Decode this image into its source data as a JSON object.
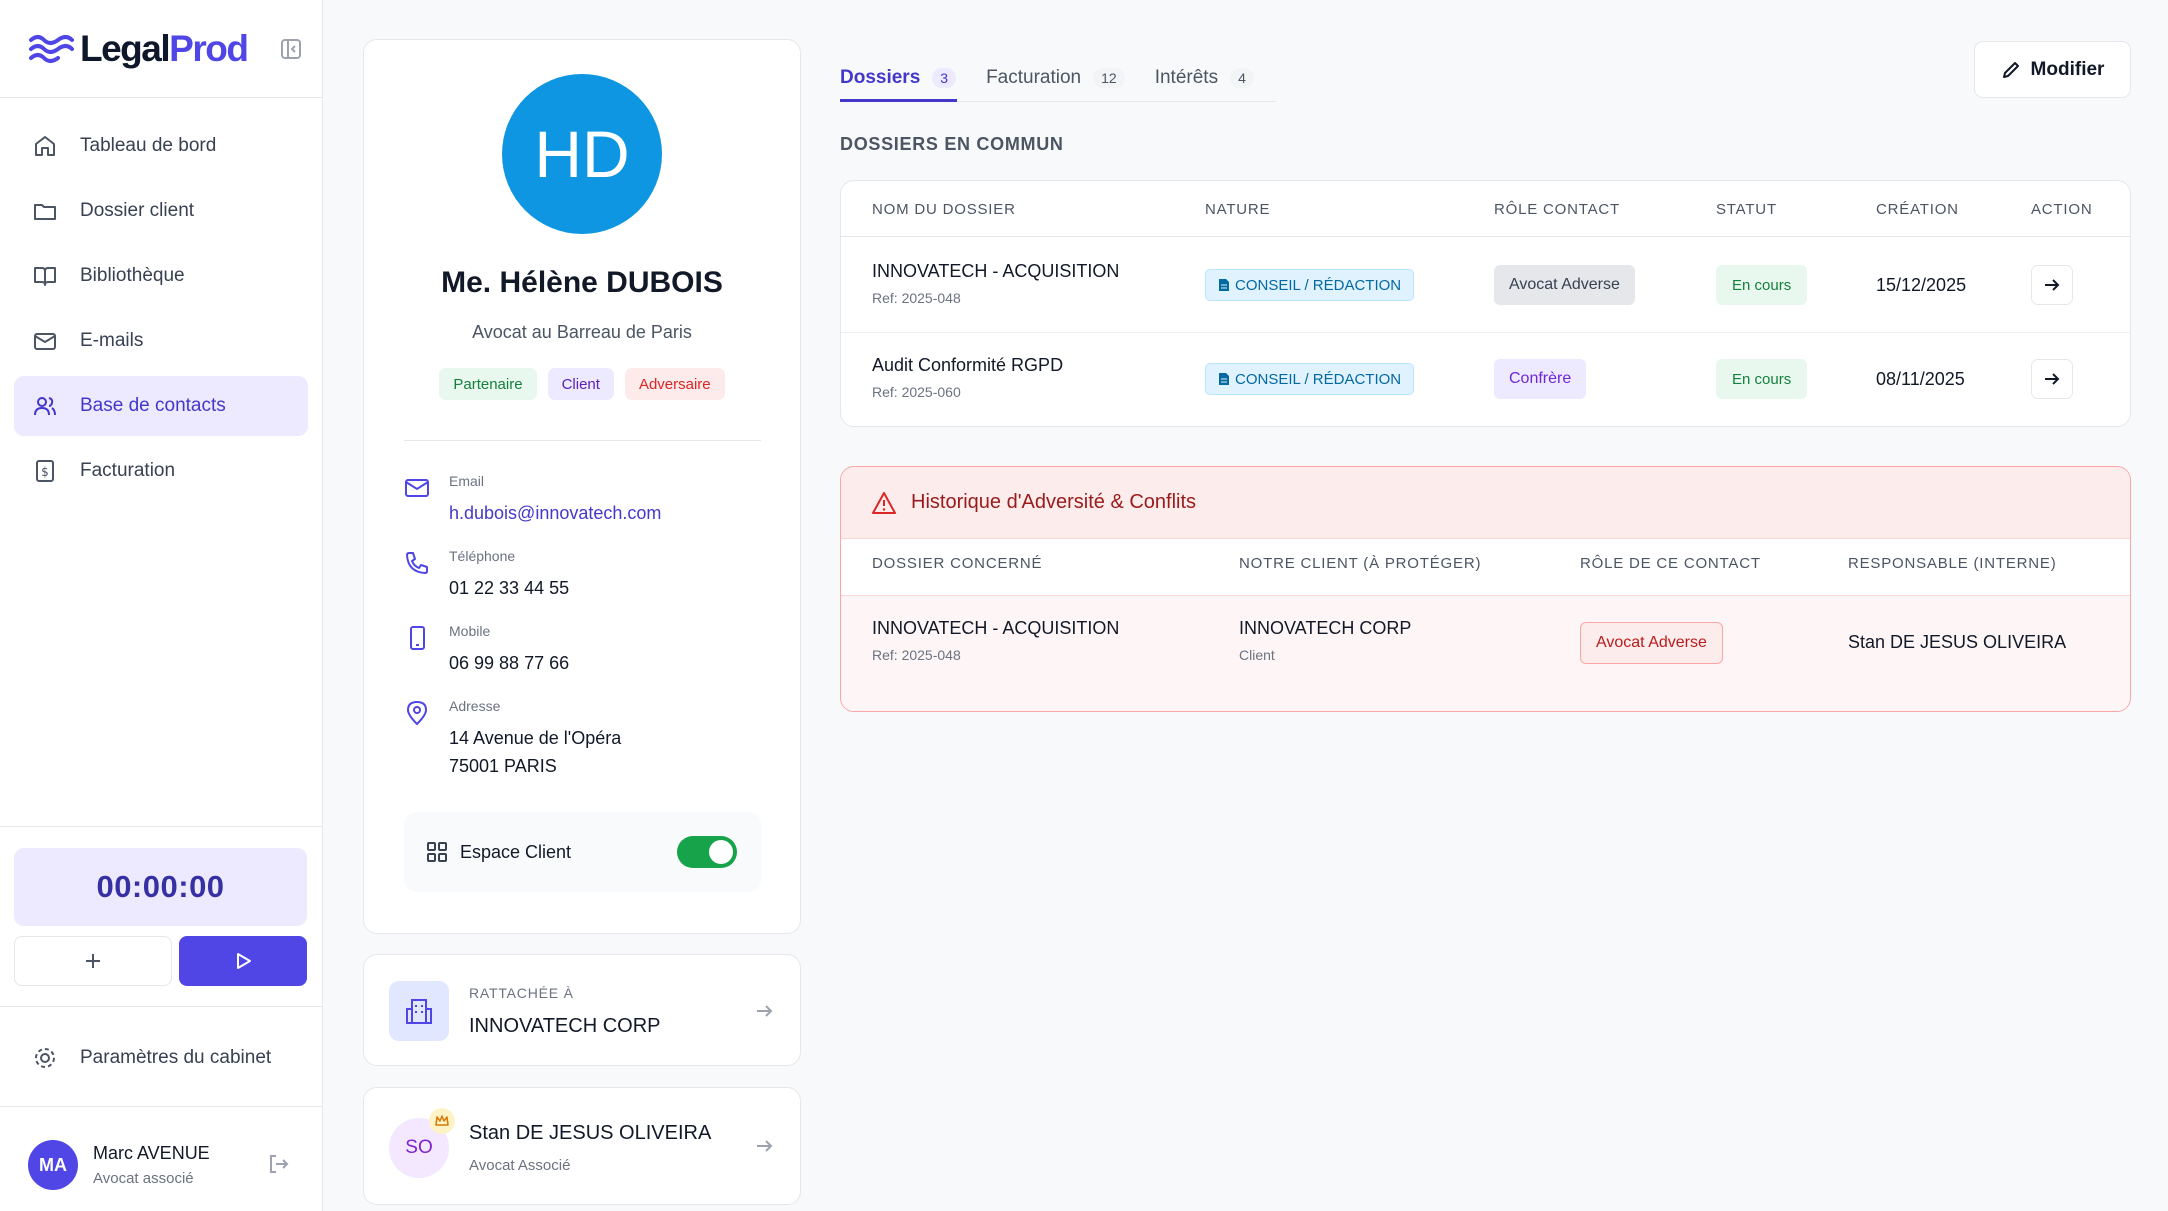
{
  "app": {
    "logo_legal": "Legal",
    "logo_prod": "Prod"
  },
  "sidebar": {
    "items": [
      {
        "label": "Tableau de bord",
        "icon": "home-icon"
      },
      {
        "label": "Dossier client",
        "icon": "folder-icon"
      },
      {
        "label": "Bibliothèque",
        "icon": "book-icon"
      },
      {
        "label": "E-mails",
        "icon": "mail-icon"
      },
      {
        "label": "Base de contacts",
        "icon": "users-icon",
        "active": true
      },
      {
        "label": "Facturation",
        "icon": "invoice-icon"
      }
    ],
    "timer": "00:00:00",
    "settings_label": "Paramètres du cabinet",
    "user": {
      "initials": "MA",
      "name": "Marc AVENUE",
      "role": "Avocat associé"
    }
  },
  "profile": {
    "initials": "HD",
    "name": "Me. Hélène DUBOIS",
    "title": "Avocat au Barreau de Paris",
    "tags": [
      "Partenaire",
      "Client",
      "Adversaire"
    ],
    "email_label": "Email",
    "email": "h.dubois@innovatech.com",
    "phone_label": "Téléphone",
    "phone": "01 22 33 44 55",
    "mobile_label": "Mobile",
    "mobile": "06 99 88 77 66",
    "address_label": "Adresse",
    "address_line1": "14 Avenue de l'Opéra",
    "address_line2": "75001 PARIS",
    "espace_client_label": "Espace Client",
    "espace_client_enabled": true
  },
  "rattachee": {
    "label": "RATTACHÉE À",
    "value": "INNOVATECH CORP"
  },
  "responsable": {
    "initials": "SO",
    "name": "Stan DE JESUS OLIVEIRA",
    "role": "Avocat Associé"
  },
  "tabs": [
    {
      "label": "Dossiers",
      "count": "3",
      "active": true
    },
    {
      "label": "Facturation",
      "count": "12"
    },
    {
      "label": "Intérêts",
      "count": "4"
    }
  ],
  "modifier_label": "Modifier",
  "dossiers": {
    "section_title": "DOSSIERS EN COMMUN",
    "headers": [
      "NOM DU DOSSIER",
      "NATURE",
      "RÔLE CONTACT",
      "STATUT",
      "CRÉATION",
      "ACTION"
    ],
    "rows": [
      {
        "name": "INNOVATECH - ACQUISITION",
        "ref": "Ref: 2025-048",
        "nature": "CONSEIL / RÉDACTION",
        "role": "Avocat Adverse",
        "status": "En cours",
        "date": "15/12/2025"
      },
      {
        "name": "Audit Conformité RGPD",
        "ref": "Ref: 2025-060",
        "nature": "CONSEIL / RÉDACTION",
        "role": "Confrère",
        "status": "En cours",
        "date": "08/11/2025"
      }
    ]
  },
  "conflicts": {
    "title": "Historique d'Adversité & Conflits",
    "headers": [
      "DOSSIER CONCERNÉ",
      "NOTRE CLIENT (À PROTÉGER)",
      "RÔLE DE CE CONTACT",
      "RESPONSABLE (INTERNE)"
    ],
    "rows": [
      {
        "dossier": "INNOVATECH - ACQUISITION",
        "ref": "Ref: 2025-048",
        "client": "INNOVATECH CORP",
        "client_type": "Client",
        "role": "Avocat Adverse",
        "responsable": "Stan DE JESUS OLIVEIRA"
      }
    ]
  },
  "colors": {
    "accent": "#4f46e5",
    "avatar_blue": "#0e96e2",
    "success": "#16a34a",
    "danger": "#dc2626"
  }
}
